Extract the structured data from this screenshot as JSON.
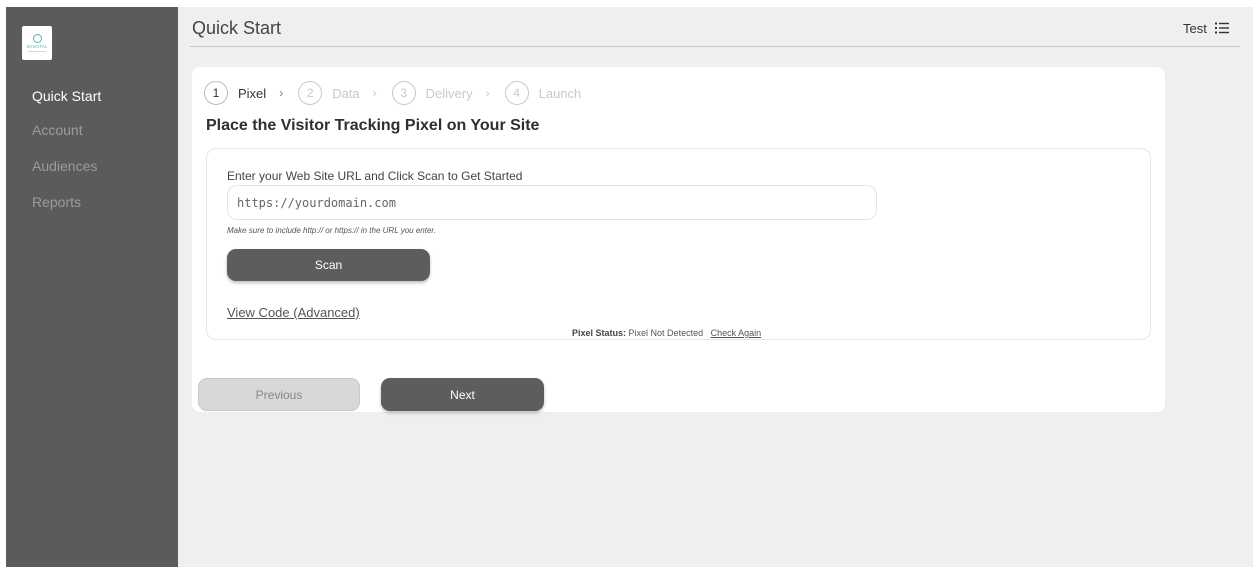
{
  "sidebar": {
    "logo_text": "SKIGITAL",
    "items": [
      {
        "label": "Quick Start",
        "active": true
      },
      {
        "label": "Account",
        "active": false
      },
      {
        "label": "Audiences",
        "active": false
      },
      {
        "label": "Reports",
        "active": false
      }
    ]
  },
  "header": {
    "title": "Quick Start",
    "user": "Test",
    "menu_icon": "list-menu-icon"
  },
  "stepper": {
    "steps": [
      {
        "number": "1",
        "label": "Pixel",
        "active": true
      },
      {
        "number": "2",
        "label": "Data",
        "active": false
      },
      {
        "number": "3",
        "label": "Delivery",
        "active": false
      },
      {
        "number": "4",
        "label": "Launch",
        "active": false
      }
    ],
    "separator": "›"
  },
  "main": {
    "heading": "Place the Visitor Tracking Pixel on Your Site",
    "url_label": "Enter your Web Site URL and Click Scan to Get Started",
    "url_placeholder": "https://yourdomain.com",
    "url_value": "",
    "hint": "Make sure to include http:// or https:// in the URL you enter.",
    "scan_label": "Scan",
    "view_code_label": "View Code (Advanced)",
    "status_key": "Pixel Status:",
    "status_value": "Pixel Not Detected",
    "check_again_label": "Check Again"
  },
  "footer": {
    "previous_label": "Previous",
    "next_label": "Next"
  },
  "colors": {
    "sidebar_bg": "#5b5b5b",
    "page_bg": "#efefef",
    "button_dark": "#5d5d5d",
    "logo_accent": "#4fb8b0"
  }
}
